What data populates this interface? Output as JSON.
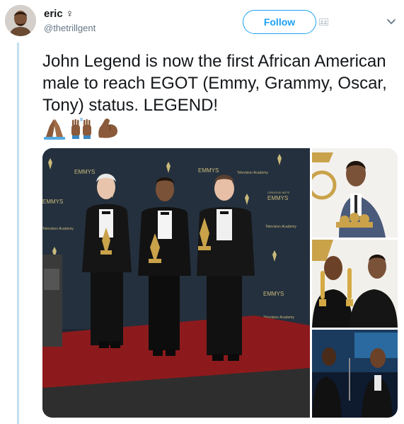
{
  "author": {
    "display_name": "eric ♀",
    "username": "@thetrillgent"
  },
  "follow_label": "Follow",
  "tweet_text": "John Legend is now the first African American male to reach EGOT (Emmy, Grammy, Oscar, Tony) status. LEGEND!",
  "emojis": [
    "folded-hands-icon",
    "raised-hands-icon",
    "flexed-biceps-icon"
  ],
  "backdrop_text": {
    "emmys": "EMMYS",
    "creative_arts": "CREATIVE ARTS",
    "tv_academy": "Television Academy"
  },
  "colors": {
    "accent": "#1da1f2",
    "thread_line": "#c4dff0",
    "secondary_text": "#657786"
  }
}
